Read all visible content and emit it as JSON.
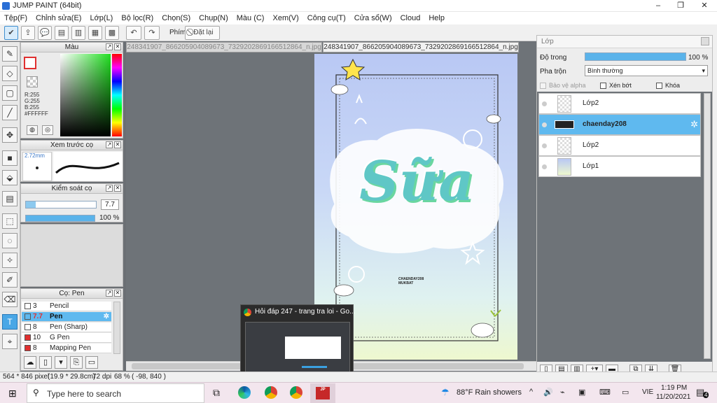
{
  "window": {
    "title": "JUMP PAINT (64bit)",
    "controls": [
      "–",
      "❐",
      "✕"
    ]
  },
  "menu": [
    "Tệp(F)",
    "Chỉnh sửa(E)",
    "Lớp(L)",
    "Bộ lọc(R)",
    "Chọn(S)",
    "Chụp(N)",
    "Màu (C)",
    "Xem(V)",
    "Công cụ(T)",
    "Cửa sổ(W)",
    "Cloud",
    "Help"
  ],
  "toolbar": {
    "key_label": "Phím",
    "reset_label": "Đặt lại"
  },
  "color_panel": {
    "title": "Màu",
    "r": "R:255",
    "g": "G:255",
    "b": "B:255",
    "hex": "#FFFFFF"
  },
  "preview_panel": {
    "title": "Xem trước cọ",
    "size": "2.72mm"
  },
  "control_panel": {
    "title": "Kiểm soát cọ",
    "size_value": "7.7",
    "opacity": "100 %",
    "opacity_fraction": 1.0
  },
  "brush_panel": {
    "title": "Cọ: Pen",
    "brushes": [
      {
        "size": "3",
        "name": "Pencil",
        "color": "#333333"
      },
      {
        "size": "7.7",
        "name": "Pen",
        "color": "#333333",
        "selected": true
      },
      {
        "size": "8",
        "name": "Pen (Sharp)",
        "color": "#333333"
      },
      {
        "size": "10",
        "name": "G Pen",
        "color": "#e03030"
      },
      {
        "size": "8",
        "name": "Mapping Pen",
        "color": "#e03030"
      }
    ]
  },
  "tabs": [
    "248341907_866205904089673_7329202869166512864_n.jpg",
    "248341907_866205904089673_7329202869166512864_n.jpg"
  ],
  "artwork": {
    "big_text": "Sữa",
    "signature": "CHAENDAY208\nMUKBAT"
  },
  "layer_panel": {
    "title": "Lớp",
    "opacity_label": "Độ trong",
    "opacity_value": "100 %",
    "opacity_fraction": 1.0,
    "blend_label": "Pha trộn",
    "blend_value": "Bình thường",
    "protect_alpha": "Bảo vệ alpha",
    "clip": "Xén bớt",
    "lock": "Khóa",
    "layers": [
      {
        "name": "Lớp2"
      },
      {
        "name": "chaenday208",
        "selected": true
      },
      {
        "name": "Lớp2"
      },
      {
        "name": "Lớp1"
      }
    ]
  },
  "status": {
    "size": "564 * 846 pixel",
    "cm": "(19.9 * 29.8cm)",
    "dpi": "72 dpi",
    "zoom": "68 %",
    "coords": "( -98, 840 )"
  },
  "popup": {
    "title": "Hỏi đáp 247 - trang tra loi - Go..."
  },
  "taskbar": {
    "search_placeholder": "Type here to search",
    "weather": "88°F  Rain showers",
    "lang": "VIE",
    "time": "1:19 PM",
    "date": "11/20/2021",
    "notif": "4"
  }
}
